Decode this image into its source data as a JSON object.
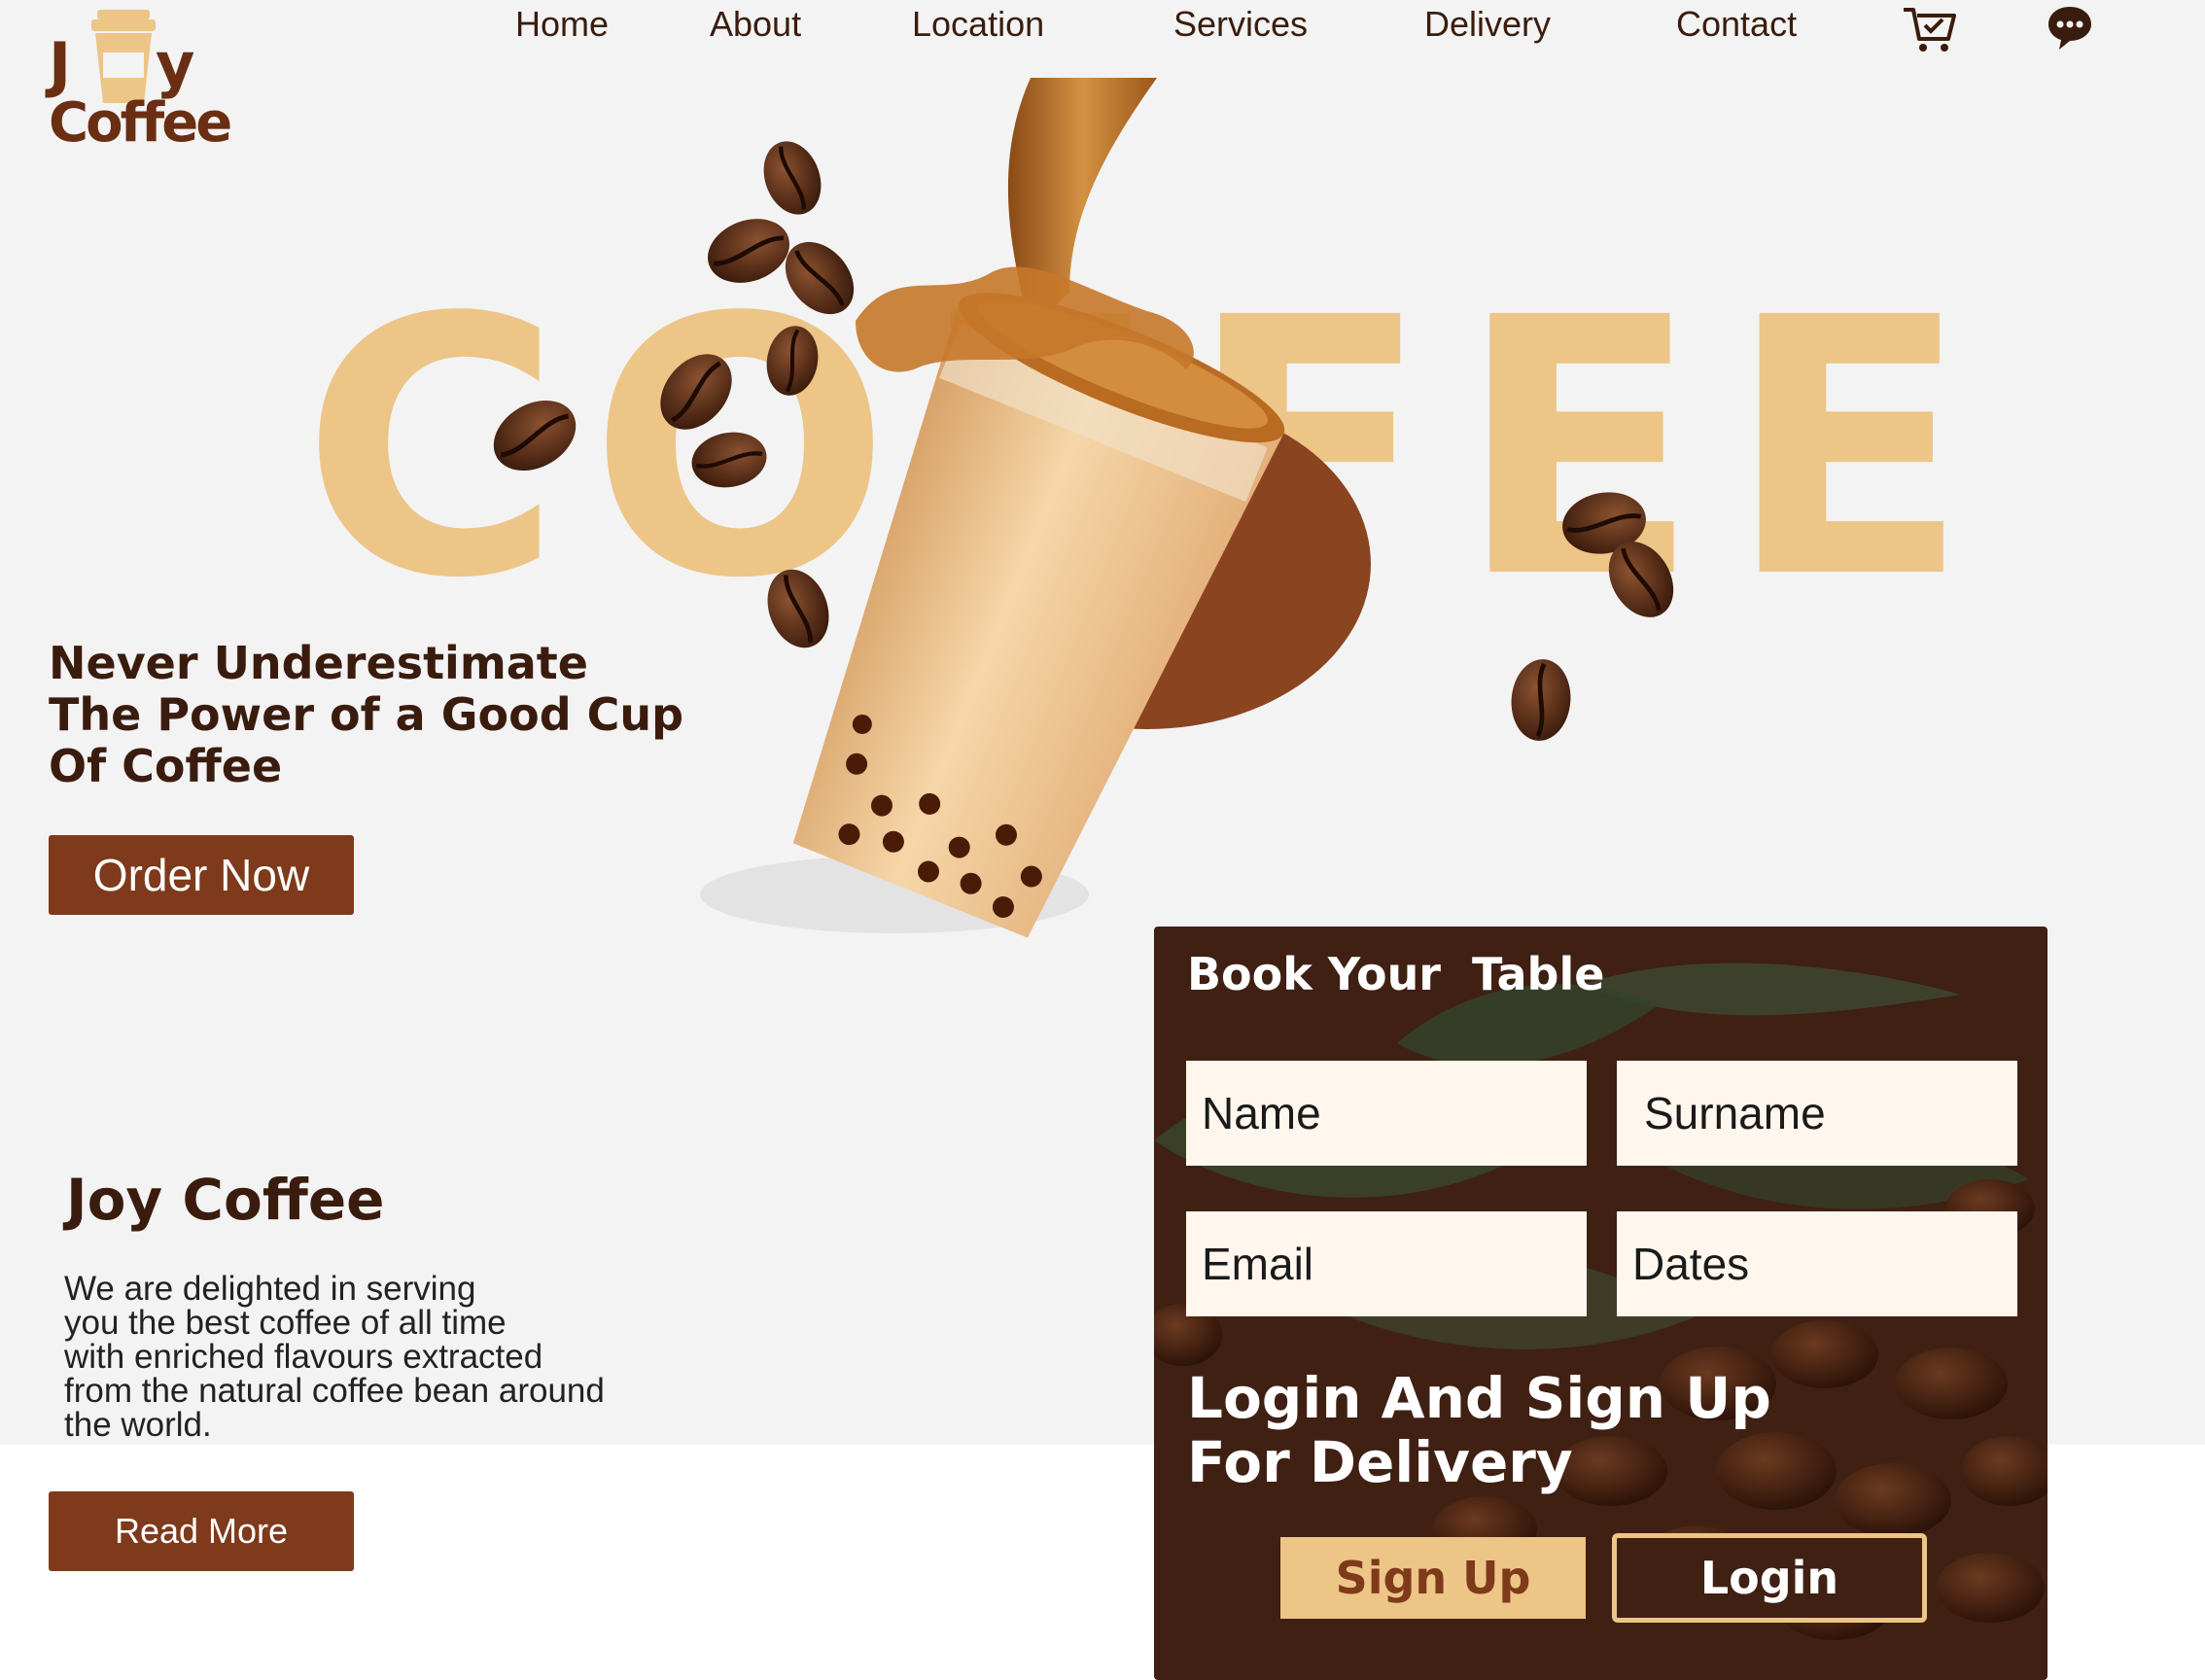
{
  "brand": {
    "logo_letter_j": "J",
    "logo_letter_y": "y",
    "logo_word": "Coffee"
  },
  "nav": {
    "items": [
      "Home",
      "About",
      "Location",
      "Services",
      "Delivery",
      "Contact"
    ],
    "icons": [
      "cart-icon",
      "chat-icon"
    ]
  },
  "hero": {
    "big_word": "COFFEE",
    "tagline_lines": [
      "Never Underestimate",
      "The Power of a Good Cup",
      "Of Coffee"
    ],
    "order_button": "Order Now"
  },
  "about": {
    "title": "Joy Coffee",
    "text_lines": [
      "We are delighted in serving",
      "you the best coffee of all time",
      "with enriched flavours extracted",
      "from the natural coffee bean around",
      "the world."
    ],
    "read_more_button": "Read More"
  },
  "booking": {
    "title": "Book Your  Table",
    "fields": {
      "name": "Name",
      "surname": "Surname",
      "email": "Email",
      "dates": "Dates"
    },
    "login_title_lines": [
      "Login And Sign Up",
      "For Delivery"
    ],
    "signup_button": "Sign Up",
    "login_button": "Login"
  },
  "colors": {
    "accent_brown": "#7e3a1b",
    "dark_brown": "#3f2013",
    "tan": "#ecc587",
    "hero_bg": "#f3f3f3"
  }
}
